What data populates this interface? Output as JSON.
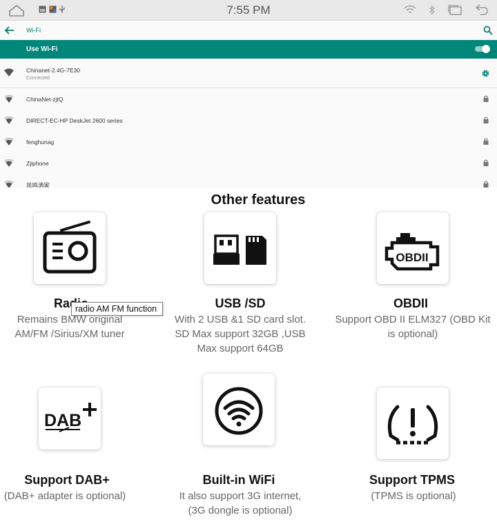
{
  "statusbar": {
    "time": "7:55 PM"
  },
  "wifi_screen": {
    "title": "Wi-Fi",
    "use_wifi_label": "Use Wi-Fi",
    "networks": [
      {
        "ssid": "Chinanet-2.4G-7E30",
        "state": "Connected"
      },
      {
        "ssid": "ChinaNet-zjtQ"
      },
      {
        "ssid": "DIRECT-EC-HP DeskJet 2600 series"
      },
      {
        "ssid": "fenghunag"
      },
      {
        "ssid": "Zjiphone"
      },
      {
        "ssid": "凤鸣酒家"
      }
    ]
  },
  "features": {
    "heading": "Other features",
    "items": [
      {
        "icon": "radio-icon",
        "title": "Radio",
        "desc": [
          "Remains BMW original",
          "AM/FM /Sirius/XM tuner"
        ]
      },
      {
        "icon": "usb-sd-icon",
        "title": "USB /SD",
        "desc": [
          "With 2 USB &1 SD card slot.",
          "SD Max support 32GB ,USB",
          "Max support 64GB"
        ]
      },
      {
        "icon": "obd-engine-icon",
        "title": "OBDII",
        "obd_label": "OBDII",
        "desc": [
          "Support OBD II ELM327 (OBD Kit",
          "is optional)"
        ]
      },
      {
        "icon": "dab-icon",
        "title": "Support DAB+",
        "dab_label": "DAB",
        "desc": [
          "(DAB+ adapter is optional)"
        ]
      },
      {
        "icon": "wifi-icon",
        "title": "Built-in WiFi",
        "desc": [
          "It also support 3G internet,",
          "(3G dongle is optional)"
        ]
      },
      {
        "icon": "tpms-icon",
        "title": "Support TPMS",
        "desc": [
          "(TPMS is optional)"
        ]
      }
    ],
    "tooltip": "radio AM FM function"
  },
  "colors": {
    "accent": "#00877a",
    "accent_text": "#00796b",
    "statusbar_bg": "#e9e9e9"
  }
}
